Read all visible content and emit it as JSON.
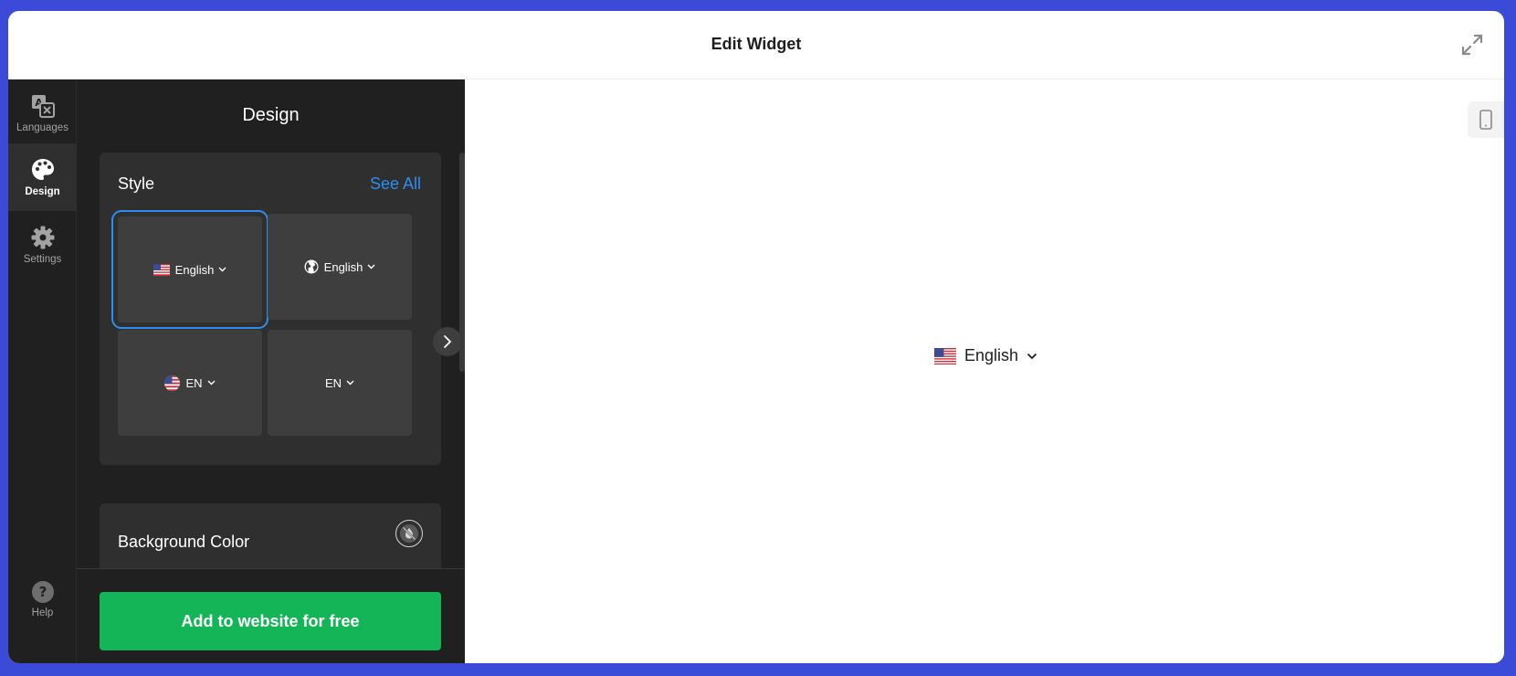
{
  "header": {
    "title": "Edit Widget",
    "expand_icon": "expand-arrows-icon"
  },
  "rail": {
    "items": [
      {
        "label": "Languages",
        "icon": "translate-icon",
        "active": false
      },
      {
        "label": "Design",
        "icon": "palette-icon",
        "active": true
      },
      {
        "label": "Settings",
        "icon": "gear-icon",
        "active": false
      },
      {
        "label": "Help",
        "icon": "help-icon",
        "active": false
      }
    ]
  },
  "panel": {
    "title": "Design",
    "style_section": {
      "heading": "Style",
      "see_all": "See All",
      "options": [
        {
          "label": "English",
          "icon": "us-flag-icon",
          "selected": true
        },
        {
          "label": "English",
          "icon": "globe-icon",
          "selected": false
        },
        {
          "label": "EN",
          "icon": "us-flag-round-icon",
          "selected": false
        },
        {
          "label": "EN",
          "icon": "",
          "selected": false
        }
      ]
    },
    "background_section": {
      "heading": "Background Color",
      "icon": "no-color-icon"
    },
    "cta_label": "Add to website for free"
  },
  "preview": {
    "widget_label": "English",
    "device_icon": "mobile-phone-icon"
  },
  "colors": {
    "page_bg": "#3b4bd8",
    "panel_bg": "#202020",
    "card_bg": "#2f2f2f",
    "option_bg": "#3e3e3e",
    "accent_blue": "#2c8ef0",
    "cta_green": "#13b556"
  }
}
